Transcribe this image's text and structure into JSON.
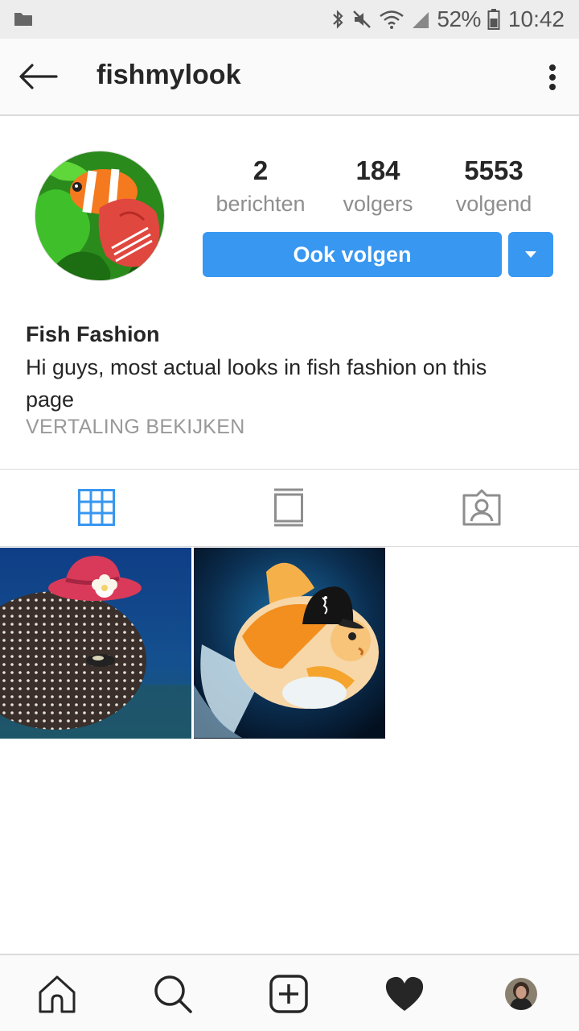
{
  "status_bar": {
    "battery": "52%",
    "time": "10:42",
    "icons": [
      "folder-icon",
      "bluetooth-icon",
      "mute-icon",
      "wifi-icon",
      "signal-icon",
      "battery-icon"
    ]
  },
  "header": {
    "username": "fishmylook",
    "icons": [
      "back-arrow-icon",
      "more-vertical-icon"
    ]
  },
  "profile": {
    "stats": [
      {
        "value": "2",
        "label": "berichten"
      },
      {
        "value": "184",
        "label": "volgers"
      },
      {
        "value": "5553",
        "label": "volgend"
      }
    ],
    "follow_button": "Ook volgen",
    "full_name": "Fish Fashion",
    "bio": "Hi guys, most actual looks in fish fashion on this page",
    "translate_link": "VERTALING BEKIJKEN"
  },
  "tabs": [
    "grid-icon",
    "feed-icon",
    "tagged-icon"
  ],
  "active_tab": "grid",
  "posts": [
    {
      "subject": "pufferfish-with-red-hat"
    },
    {
      "subject": "goldfish-with-black-cap"
    }
  ],
  "bottom_nav": [
    "home-icon",
    "search-icon",
    "add-post-icon",
    "heart-icon",
    "profile-avatar"
  ],
  "colors": {
    "accent": "#3897f0",
    "text": "#262626",
    "muted": "#8e8e8e",
    "divider": "#dbdbdb"
  }
}
